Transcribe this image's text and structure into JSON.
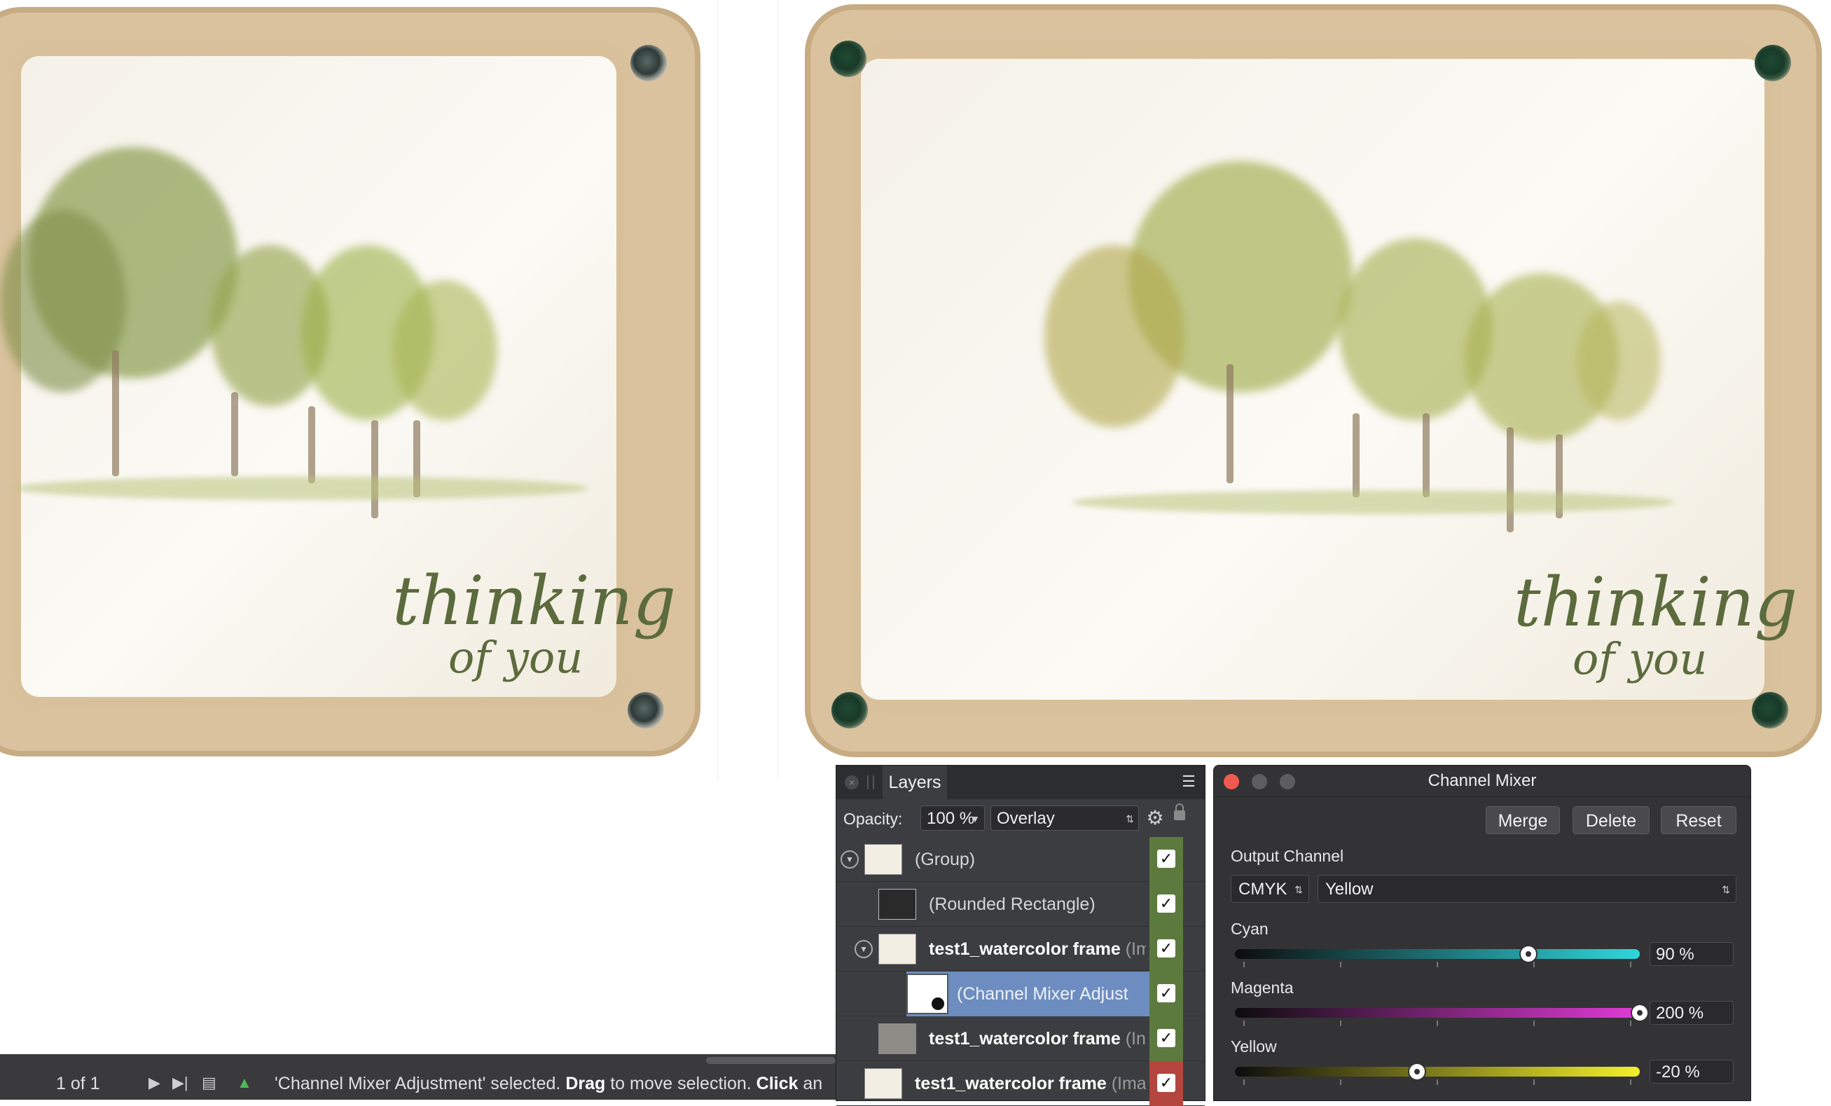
{
  "canvas": {
    "left_card": {
      "script_line1": "thinking",
      "script_line2": "of you"
    },
    "right_card": {
      "script_line1": "thinking",
      "script_line2": "of you"
    }
  },
  "layers_panel": {
    "tab_label": "Layers",
    "close_icon": "close-icon",
    "menu_icon": "panel-menu-icon",
    "opacity_label": "Opacity:",
    "opacity_value": "100 %",
    "blend_mode": "Overlay",
    "rows": [
      {
        "name": "(Group)",
        "type": "",
        "bold": false,
        "visible": true
      },
      {
        "name": "(Rounded Rectangle)",
        "type": "",
        "bold": false,
        "visible": true
      },
      {
        "name": "test1_watercolor frame",
        "type": "(Im",
        "bold": true,
        "visible": true
      },
      {
        "name": "(Channel Mixer Adjust",
        "type": "",
        "bold": false,
        "visible": true
      },
      {
        "name": "test1_watercolor frame",
        "type": "(In",
        "bold": true,
        "visible": true
      },
      {
        "name": "test1_watercolor frame",
        "type": "(Ima",
        "bold": true,
        "visible": true
      }
    ],
    "check_mark": "✓"
  },
  "channel_mixer": {
    "title": "Channel Mixer",
    "buttons": {
      "merge": "Merge",
      "delete": "Delete",
      "reset": "Reset"
    },
    "output_channel_label": "Output Channel",
    "color_model": "CMYK",
    "output_channel": "Yellow",
    "sliders": [
      {
        "label": "Cyan",
        "value_text": "90 %",
        "value": 90,
        "min": -200,
        "max": 200,
        "gradient": [
          "#0d0d0d",
          "#2fd6dc"
        ]
      },
      {
        "label": "Magenta",
        "value_text": "200 %",
        "value": 200,
        "min": -200,
        "max": 200,
        "gradient": [
          "#0d0d0d",
          "#e13ad8"
        ]
      },
      {
        "label": "Yellow",
        "value_text": "-20 %",
        "value": -20,
        "min": -200,
        "max": 200,
        "gradient": [
          "#0d0d0d",
          "#f4f02a"
        ]
      }
    ]
  },
  "status_bar": {
    "page_indicator": "1 of 1",
    "message_prefix": "'Channel Mixer Adjustment' selected. ",
    "drag": "Drag",
    "message_mid": " to move selection. ",
    "click": "Click",
    "message_suffix": " an"
  },
  "colors": {
    "visibility_green": "#5c7a3e",
    "visibility_red": "#b4453f",
    "selection_blue": "#6d8dc0"
  }
}
